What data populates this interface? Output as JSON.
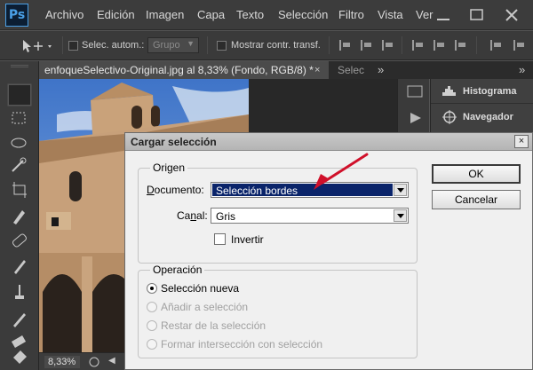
{
  "app": {
    "logo": "Ps"
  },
  "menubar": {
    "items": [
      "Archivo",
      "Edición",
      "Imagen",
      "Capa",
      "Texto",
      "Selección",
      "Filtro",
      "Vista",
      "Ver"
    ]
  },
  "options": {
    "auto_select_label": "Selec. autom.:",
    "group_value": "Grupo",
    "show_transform_label": "Mostrar contr. transf."
  },
  "tabs": {
    "active": "enfoqueSelectivo-Original.jpg al 8,33% (Fondo, RGB/8) *",
    "close": "×",
    "second": "Selec",
    "overflow": "»"
  },
  "status": {
    "zoom": "8,33%"
  },
  "panels": {
    "items": [
      {
        "label": "Histograma",
        "icon": "histogram-icon"
      },
      {
        "label": "Navegador",
        "icon": "navigator-icon"
      }
    ]
  },
  "dialog": {
    "title": "Cargar selección",
    "close": "×",
    "origin": {
      "legend": "Origen",
      "document_label": "Documento:",
      "document_value": "Selección bordes",
      "channel_label": "Canal:",
      "channel_value": "Gris",
      "invert_label": "Invertir",
      "invert_checked": false
    },
    "operation": {
      "legend": "Operación",
      "options": [
        {
          "label": "Selección nueva",
          "selected": true,
          "enabled": true
        },
        {
          "label": "Añadir a selección",
          "selected": false,
          "enabled": false
        },
        {
          "label": "Restar de la selección",
          "selected": false,
          "enabled": false
        },
        {
          "label": "Formar intersección con selección",
          "selected": false,
          "enabled": false
        }
      ]
    },
    "buttons": {
      "ok": "OK",
      "cancel": "Cancelar"
    }
  },
  "colors": {
    "annotation_arrow": "#d0102a",
    "selection_highlight": "#0a246a",
    "ps_accent": "#4aa0e6"
  }
}
